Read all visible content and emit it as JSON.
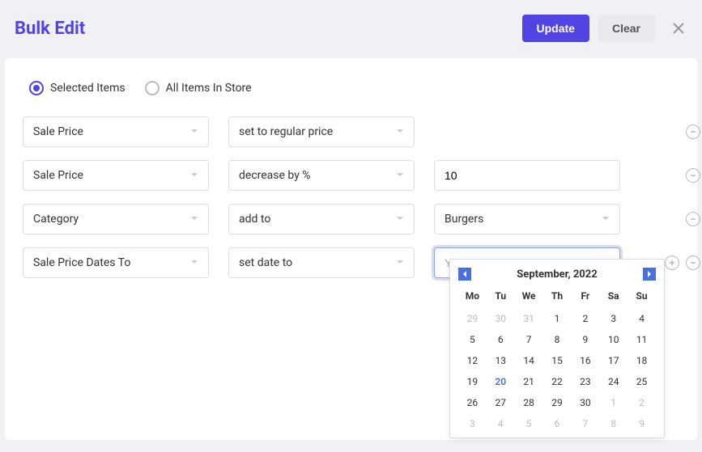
{
  "header": {
    "title": "Bulk Edit",
    "update": "Update",
    "clear": "Clear"
  },
  "scope": {
    "selected": "Selected Items",
    "all": "All Items In Store",
    "active": "selected"
  },
  "rows": [
    {
      "field": "Sale Price",
      "op": "set to regular price",
      "value": null,
      "value_type": "none"
    },
    {
      "field": "Sale Price",
      "op": "decrease by %",
      "value": "10",
      "value_type": "text"
    },
    {
      "field": "Category",
      "op": "add to",
      "value": "Burgers",
      "value_type": "select"
    },
    {
      "field": "Sale Price Dates To",
      "op": "set date to",
      "value": "",
      "placeholder": "YYYY-MM-DD",
      "value_type": "date"
    }
  ],
  "calendar": {
    "title": "September, 2022",
    "dow": [
      "Mo",
      "Tu",
      "We",
      "Th",
      "Fr",
      "Sa",
      "Su"
    ],
    "days": [
      {
        "n": 29,
        "m": true
      },
      {
        "n": 30,
        "m": true
      },
      {
        "n": 31,
        "m": true
      },
      {
        "n": 1
      },
      {
        "n": 2
      },
      {
        "n": 3
      },
      {
        "n": 4
      },
      {
        "n": 5
      },
      {
        "n": 6
      },
      {
        "n": 7
      },
      {
        "n": 8
      },
      {
        "n": 9
      },
      {
        "n": 10
      },
      {
        "n": 11
      },
      {
        "n": 12
      },
      {
        "n": 13
      },
      {
        "n": 14
      },
      {
        "n": 15
      },
      {
        "n": 16
      },
      {
        "n": 17
      },
      {
        "n": 18
      },
      {
        "n": 19
      },
      {
        "n": 20,
        "t": true
      },
      {
        "n": 21
      },
      {
        "n": 22
      },
      {
        "n": 23
      },
      {
        "n": 24
      },
      {
        "n": 25
      },
      {
        "n": 26
      },
      {
        "n": 27
      },
      {
        "n": 28
      },
      {
        "n": 29
      },
      {
        "n": 30
      },
      {
        "n": 1,
        "m": true
      },
      {
        "n": 2,
        "m": true
      },
      {
        "n": 3,
        "m": true
      },
      {
        "n": 4,
        "m": true
      },
      {
        "n": 5,
        "m": true
      },
      {
        "n": 6,
        "m": true
      },
      {
        "n": 7,
        "m": true
      },
      {
        "n": 8,
        "m": true
      },
      {
        "n": 9,
        "m": true
      }
    ]
  }
}
